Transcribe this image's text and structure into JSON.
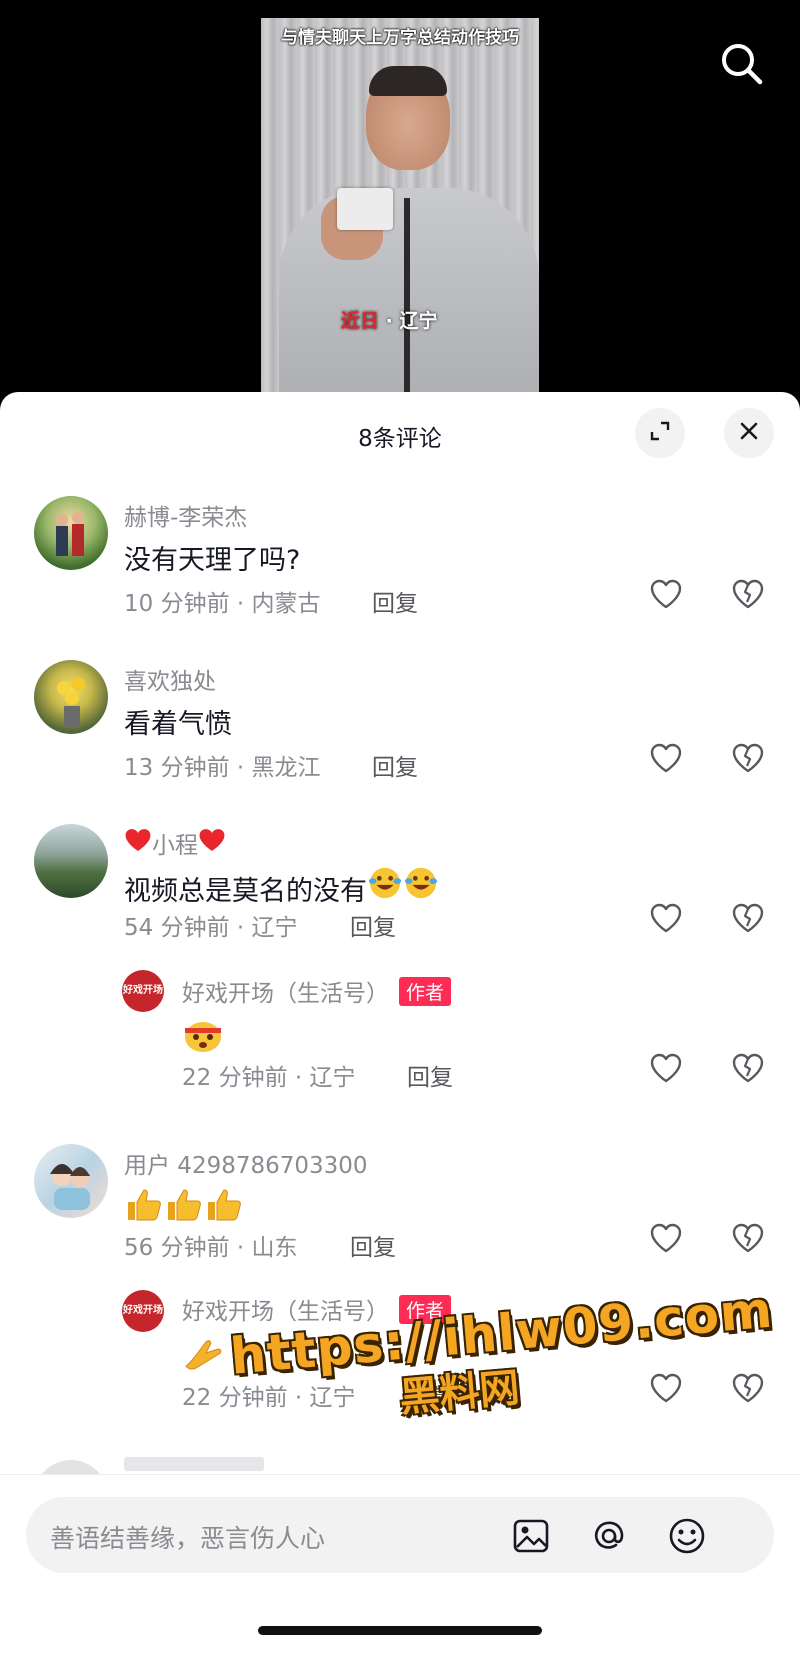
{
  "video": {
    "caption": "与情夫聊天上万字总结动作技巧",
    "location_prefix": "近日",
    "location_sep": "·",
    "location_place": "辽宁"
  },
  "sheet": {
    "title": "8条评论"
  },
  "comments": [
    {
      "nickname": "赫博-李荣杰",
      "text": "没有天理了吗?",
      "time": "10 分钟前 · 内蒙古",
      "reply_label": "回复"
    },
    {
      "nickname": "喜欢独处",
      "text": "看着气愤",
      "time": "13 分钟前 · 黑龙江",
      "reply_label": "回复"
    },
    {
      "nickname": "小程",
      "text": "视频总是莫名的没有",
      "time": "54 分钟前 · 辽宁",
      "reply_label": "回复",
      "reply": {
        "nickname": "好戏开场（生活号）",
        "badge": "作者",
        "avatar_text": "好戏开场",
        "time": "22 分钟前 · 辽宁",
        "reply_label": "回复"
      }
    },
    {
      "nickname": "用户 4298786703300",
      "text": "",
      "time": "56 分钟前 · 山东",
      "reply_label": "回复",
      "reply": {
        "nickname": "好戏开场（生活号）",
        "badge": "作者",
        "avatar_text": "好戏开场",
        "time": "22 分钟前 · 辽宁",
        "reply_label": "回复"
      }
    }
  ],
  "watermark": {
    "url": "https://ihlw09.com",
    "name": "黑料网"
  },
  "input_bar": {
    "placeholder": "善语结善缘，恶言伤人心"
  },
  "icons": {
    "search": "search-icon",
    "expand": "expand-icon",
    "close": "close-icon",
    "like": "heart-icon",
    "dislike": "broken-heart-icon",
    "image": "image-icon",
    "mention": "at-icon",
    "emoji": "smiley-icon"
  },
  "colors": {
    "accent": "#fe2c55",
    "watermark": "#f4a623"
  }
}
